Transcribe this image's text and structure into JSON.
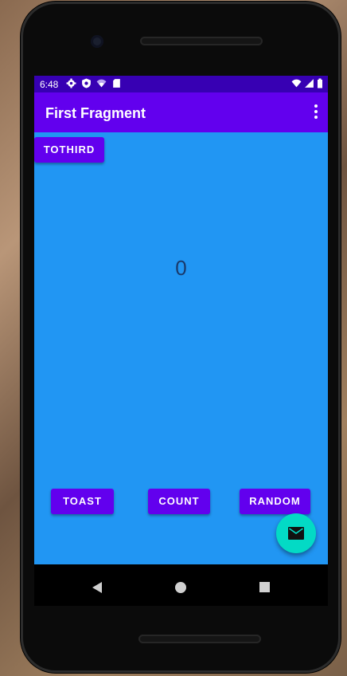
{
  "statusbar": {
    "time": "6:48"
  },
  "appbar": {
    "title": "First Fragment"
  },
  "buttons": {
    "tothird": "TOTHIRD",
    "toast": "TOAST",
    "count": "COUNT",
    "random": "RANDOM"
  },
  "counter": {
    "value": "0"
  },
  "colors": {
    "primary": "#6200ee",
    "primary_dark": "#3700b3",
    "content_bg": "#2196f3",
    "fab": "#03dac5"
  },
  "icons": {
    "status_left": [
      "settings-icon",
      "shield-icon",
      "wifi-question-icon",
      "sd-card-icon"
    ],
    "status_right": [
      "wifi-icon",
      "signal-icon",
      "battery-icon"
    ],
    "fab": "mail-icon",
    "overflow": "more-vert-icon"
  }
}
